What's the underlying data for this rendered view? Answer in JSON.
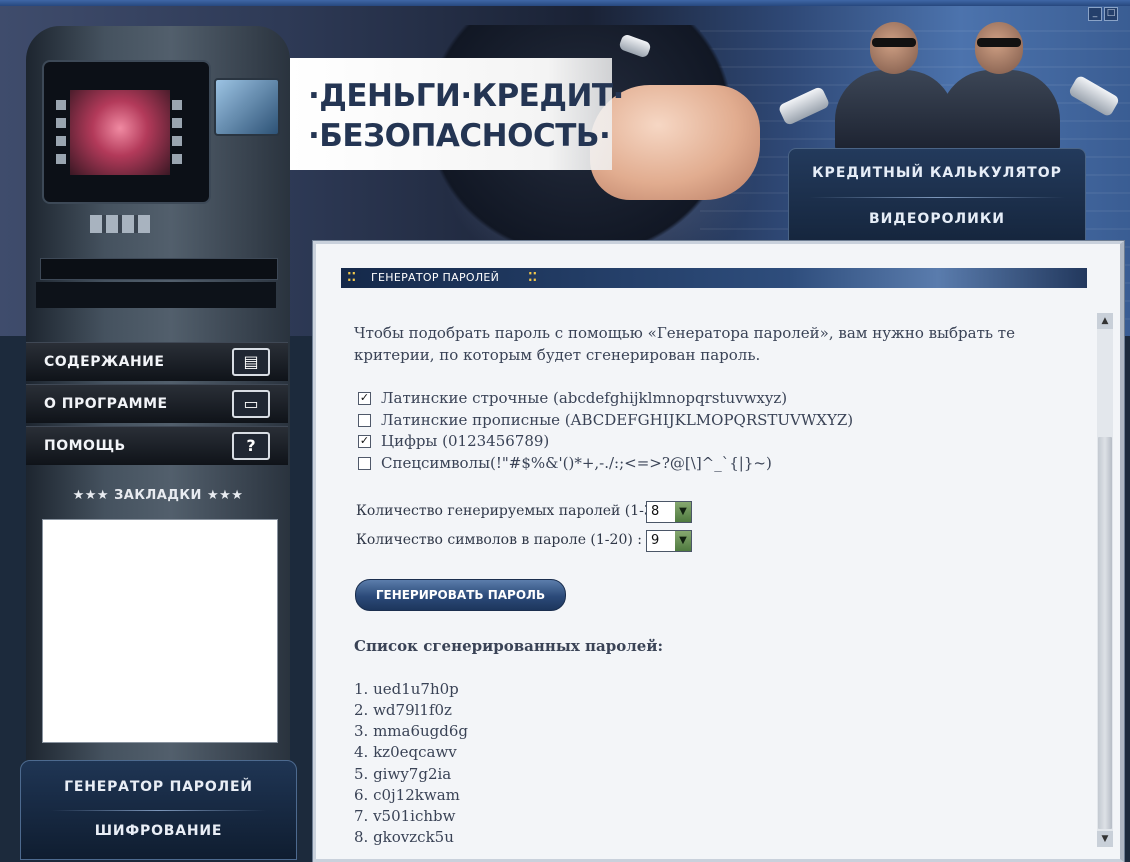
{
  "window": {
    "controls": [
      "_",
      "□"
    ]
  },
  "banner": {
    "title_line1": "·ДЕНЬГИ·КРЕДИТ·",
    "title_line2": "·БЕЗОПАСНОСТЬ·"
  },
  "top_menu": {
    "items": [
      {
        "label": "КРЕДИТНЫЙ КАЛЬКУЛЯТОР"
      },
      {
        "label": "ВИДЕОРОЛИКИ"
      }
    ]
  },
  "left_nav": {
    "items": [
      {
        "label": "СОДЕРЖАНИЕ",
        "icon": "book-icon"
      },
      {
        "label": "О ПРОГРАММЕ",
        "icon": "card-icon"
      },
      {
        "label": "ПОМОЩЬ",
        "icon": "help-icon",
        "glyph": "?"
      }
    ],
    "bookmarks_title": "★★★ ЗАКЛАДКИ ★★★"
  },
  "bottom_menu": {
    "items": [
      {
        "label": "ГЕНЕРАТОР ПАРОЛЕЙ"
      },
      {
        "label": "ШИФРОВАНИЕ"
      }
    ]
  },
  "content": {
    "section_title": "ГЕНЕРАТОР ПАРОЛЕЙ",
    "intro": "Чтобы подобрать пароль с помощью «Генератора паролей», вам нужно выбрать те критерии, по которым будет сгенерирован пароль.",
    "options": [
      {
        "label": "Латинские строчные (abcdefghijklmnopqrstuvwxyz)",
        "checked": true
      },
      {
        "label": "Латинские прописные (ABCDEFGHIJKLMOPQRSTUVWXYZ)",
        "checked": false
      },
      {
        "label": "Цифры (0123456789)",
        "checked": true
      },
      {
        "label": "Спецсимволы(!\"#$%&'()*+,-./:;<=>?@[\\]^_`{|}~)",
        "checked": false
      }
    ],
    "count_label": "Количество генерируемых паролей (1-30) :",
    "count_value": "8",
    "length_label": "Количество символов в пароле (1-20) :",
    "length_value": "9",
    "generate_button": "ГЕНЕРИРОВАТЬ ПАРОЛЬ",
    "list_title": "Список сгенерированных паролей:",
    "passwords": [
      "1. ued1u7h0p",
      "2. wd79l1f0z",
      "3. mma6ugd6g",
      "4. kz0eqcawv",
      "5. giwy7g2ia",
      "6. c0j12kwam",
      "7. v501ichbw",
      "8. gkovzck5u"
    ]
  },
  "colors": {
    "accent": "#2b4a79",
    "header_dots": "#f2c84b",
    "text": "#3a4356"
  }
}
